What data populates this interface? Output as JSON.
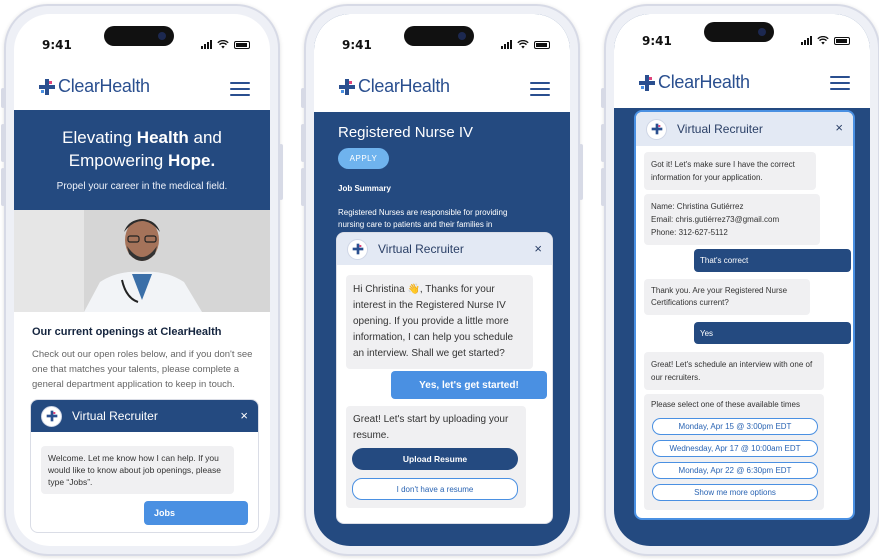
{
  "status": {
    "time": "9:41"
  },
  "brand": {
    "logo_text": "ClearHealth"
  },
  "phone1": {
    "hero_line1_a": "Elevating ",
    "hero_line1_b": "Health",
    "hero_line1_c": " and",
    "hero_line2_a": "Empowering ",
    "hero_line2_b": "Hope.",
    "hero_sub": "Propel your career in the medical field.",
    "openings_title": "Our current openings at ClearHealth",
    "openings_text": "Check out our open roles below, and if you don't see one that matches your talents, please complete a general department application to keep in touch.",
    "chat": {
      "title": "Virtual Recruiter",
      "close": "×",
      "bot_msg": "Welcome. Let me know how I can help. If you would like to know about job openings, please type “Jobs”.",
      "user_msg": "Jobs"
    }
  },
  "phone2": {
    "job_title": "Registered Nurse IV",
    "apply_label": "APPLY",
    "summary_heading": "Job Summary",
    "summary_text": "Registered Nurses are responsible for providing nursing care to patients  and their families in",
    "chat": {
      "title": "Virtual Recruiter",
      "close": "×",
      "bot_msg1": "Hi Christina 👋, Thanks for your interest in the Registered Nurse IV opening. If you provide a little more information, I can help you schedule an interview. Shall we get started?",
      "user_msg": "Yes, let's get started!",
      "bot_msg2": "Great! Let's start by uploading your resume.",
      "upload_label": "Upload Resume",
      "no_resume_label": "I don't have a resume"
    }
  },
  "phone3": {
    "chat": {
      "title": "Virtual Recruiter",
      "close": "×",
      "bot_msg1": "Got it! Let's make sure I have the correct information for your application.",
      "info_name": "Name: Christina Gutiérrez",
      "info_email": "Email: chris.gutiérrez73@gmail.com",
      "info_phone": "Phone: 312-627-5112",
      "user_msg1": "That's correct",
      "bot_msg2": "Thank you. Are your Registered Nurse Certifications current?",
      "user_msg2": "Yes",
      "bot_msg3": "Great! Let's schedule an interview with one of our recruiters.",
      "bot_msg4": "Please select one of these available times",
      "options": [
        "Monday, Apr 15 @ 3:00pm EDT",
        "Wednesday, Apr 17 @ 10:00am EDT",
        "Monday, Apr 22 @ 6:30pm EDT",
        "Show me more options"
      ]
    }
  },
  "colors": {
    "navy": "#244a80",
    "accent_blue": "#4a90e2",
    "apply_blue": "#6fb3ee",
    "bubble_gray": "#f0f0f2"
  }
}
